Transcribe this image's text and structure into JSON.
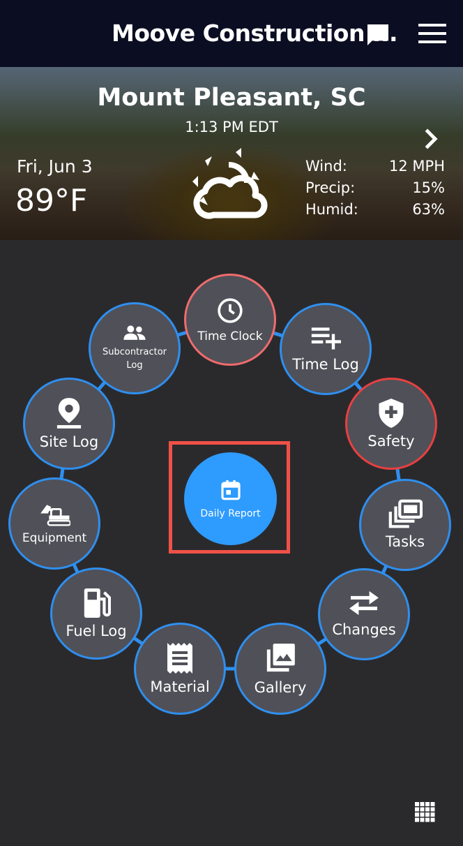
{
  "header": {
    "title": "Moove Construction ...",
    "chat_icon": "chat-icon",
    "menu_icon": "hamburger-menu-icon"
  },
  "weather": {
    "location": "Mount Pleasant, SC",
    "time": "1:13 PM EDT",
    "date": "Fri, Jun 3",
    "temperature": "89°F",
    "condition_icon": "partly-sunny-icon",
    "stats": [
      {
        "label": "Wind:",
        "value": "12 MPH"
      },
      {
        "label": "Precip:",
        "value": "15%"
      },
      {
        "label": "Humid:",
        "value": "63%"
      }
    ]
  },
  "menu": {
    "time_clock": "Time Clock",
    "time_log": "Time Log",
    "safety": "Safety",
    "tasks": "Tasks",
    "changes": "Changes",
    "gallery": "Gallery",
    "material": "Material",
    "fuel_log": "Fuel Log",
    "equipment": "Equipment",
    "site_log": "Site Log",
    "subcontractor_log_1": "Subcontractor",
    "subcontractor_log_2": "Log",
    "daily_report": "Daily Report"
  },
  "colors": {
    "accent": "#2e9bff",
    "ring_blue": "#2f8fee",
    "alert_red": "#e84040",
    "highlight": "#f05147",
    "header_bg": "#0b0d22"
  }
}
